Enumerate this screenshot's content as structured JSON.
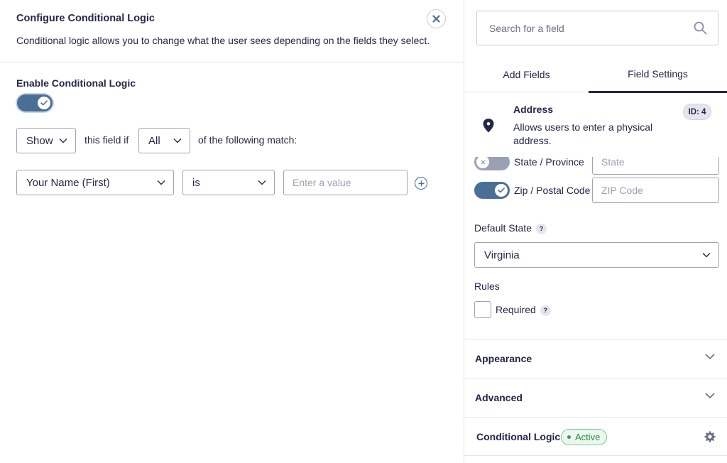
{
  "colors": {
    "accent": "#4a6f96",
    "text": "#242748",
    "border": "#9ea2b3",
    "success": "#2a8b44",
    "success_bg": "#ecf8ef"
  },
  "modal": {
    "title": "Configure Conditional Logic",
    "description": "Conditional logic allows you to change what the user sees depending on the fields they select.",
    "close_icon": "close-icon",
    "enable_label": "Enable Conditional Logic",
    "enabled": true,
    "rule_header": {
      "action": "Show",
      "text_mid": "this field if",
      "match": "All",
      "text_end": "of the following match:"
    },
    "rules": [
      {
        "field": "Your Name (First)",
        "operator": "is",
        "value_placeholder": "Enter a value"
      }
    ]
  },
  "sidebar": {
    "search_placeholder": "Search for a field",
    "tabs": [
      "Add Fields",
      "Field Settings"
    ],
    "active_tab": 1,
    "field": {
      "name": "Address",
      "description": "Allows users to enter a physical address.",
      "id_label": "ID: 4",
      "icon": "map-pin-icon"
    },
    "subfields": [
      {
        "label": "State / Province",
        "enabled": false,
        "placeholder": "State"
      },
      {
        "label": "Zip / Postal Code",
        "enabled": true,
        "placeholder": "ZIP Code"
      }
    ],
    "default_state_label": "Default State",
    "default_state_value": "Virginia",
    "rules_label": "Rules",
    "required_label": "Required",
    "help_glyph": "?",
    "sections": [
      {
        "label": "Appearance"
      },
      {
        "label": "Advanced"
      },
      {
        "label": "Conditional Logic",
        "badge": "Active"
      }
    ]
  }
}
